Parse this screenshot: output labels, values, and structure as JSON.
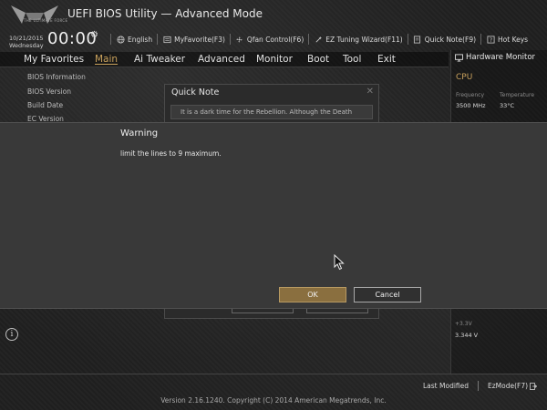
{
  "header": {
    "title": "UEFI BIOS Utility — Advanced Mode",
    "logo_text": "THE ULTIMATE FORCE",
    "date": "10/21/2015",
    "weekday": "Wednesday",
    "time": "00:00",
    "toolbar": [
      {
        "label": "English",
        "icon": "globe-icon"
      },
      {
        "label": "MyFavorite(F3)",
        "icon": "favorite-icon"
      },
      {
        "label": "Qfan Control(F6)",
        "icon": "fan-icon"
      },
      {
        "label": "EZ Tuning Wizard(F11)",
        "icon": "wizard-icon"
      },
      {
        "label": "Quick Note(F9)",
        "icon": "note-icon"
      },
      {
        "label": "Hot Keys",
        "icon": "help-icon"
      }
    ]
  },
  "menu": {
    "items": [
      "My Favorites",
      "Main",
      "Ai Tweaker",
      "Advanced",
      "Monitor",
      "Boot",
      "Tool",
      "Exit"
    ],
    "active": "Main"
  },
  "main": {
    "info_items": [
      "BIOS Information",
      "BIOS Version",
      "Build Date",
      "EC Version"
    ]
  },
  "hardware_monitor": {
    "title": "Hardware Monitor",
    "section": "CPU",
    "frequency_label": "Frequency",
    "frequency_value": "3500 MHz",
    "temperature_label": "Temperature",
    "temperature_value": "33°C",
    "voltage_label": "+3.3V",
    "voltage_value": "3.344 V"
  },
  "quick_note": {
    "title": "Quick Note",
    "text": "It is a dark time for the Rebellion. Although the Death"
  },
  "warning": {
    "title": "Warning",
    "message": "limit the lines to 9 maximum.",
    "ok_label": "OK",
    "cancel_label": "Cancel"
  },
  "footer": {
    "last_modified": "Last Modified",
    "ezmode": "EzMode(F7)",
    "version": "Version 2.16.1240. Copyright (C) 2014 American Megatrends, Inc."
  },
  "colors": {
    "accent": "#c9a15c",
    "ok_button": "#8a6f3f",
    "dialog_bg": "#393939"
  }
}
